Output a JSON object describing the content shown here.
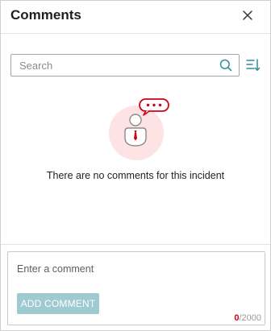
{
  "header": {
    "title": "Comments"
  },
  "search": {
    "placeholder": "Search"
  },
  "empty_state": {
    "message": "There are no comments for this incident"
  },
  "composer": {
    "placeholder": "Enter a comment",
    "add_button_label": "ADD COMMENT",
    "char_count": "0",
    "char_limit": "/2000"
  },
  "icons": {
    "close": "close-icon",
    "search": "search-icon",
    "sort": "sort-icon",
    "empty": "no-comments-illustration"
  },
  "colors": {
    "accent_teal": "#2f8f9d",
    "button_disabled": "#9ecad0",
    "alert_red": "#d0021b",
    "illustration_bg": "#fde3e3"
  }
}
